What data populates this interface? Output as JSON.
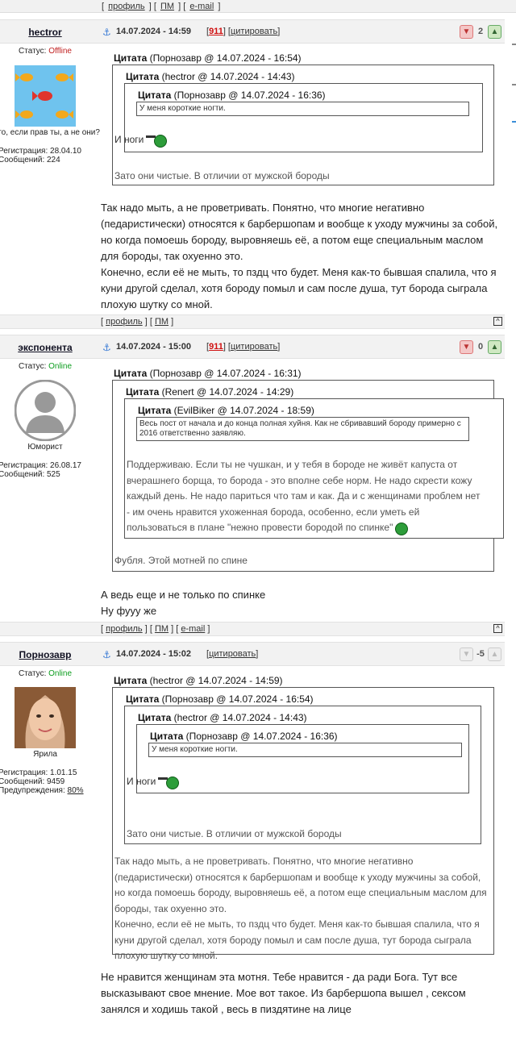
{
  "topbar": {
    "profile": "профиль",
    "pm": "ПМ",
    "email": "e-mail"
  },
  "common": {
    "quote_word": "Цитата",
    "cite_link": "цитировать",
    "profile_link": "профиль",
    "pm_link": "ПМ",
    "email_link": "e-mail",
    "to_top": "^",
    "status_label": "Статус:"
  },
  "posts": [
    {
      "author": "hectror",
      "status": "Offline",
      "tagline": "что, если прав ты, а не они?",
      "registration": "Регистрация: 28.04.10",
      "messages": "Сообщений: 224",
      "date": "14.07.2024 - 14:59",
      "badge": "911",
      "rating": "2",
      "quote1_head": "(Порнозавр @ 14.07.2024 - 16:54)",
      "quote2_head": "(hectror @ 14.07.2024 - 14:43)",
      "quote3_head": "(Порнозавр @ 14.07.2024 - 16:36)",
      "quote3_text": "У меня короткие ногти.",
      "quote2_text": "И ноги",
      "quote1_text": "Зато они чистые. В отличии от мужской бороды",
      "text1": "Так надо мыть, а не проветривать. Понятно, что многие негативно (педаристически) относятся к барбершопам и вообще к уходу мужчины за собой, но когда помоешь бороду, выровняешь её, а потом еще специальным маслом для бороды, так охуенно это.",
      "text2": "Конечно, если её не мыть, то пздц что будет. Меня как-то бывшая спалила, что я куни другой сделал, хотя бороду помыл и сам после душа, тут борода сыграла плохую шутку со мной."
    },
    {
      "author": "экспонента",
      "status": "Online",
      "tagline": "Юморист",
      "registration": "Регистрация: 26.08.17",
      "messages": "Сообщений: 525",
      "date": "14.07.2024 - 15:00",
      "badge": "911",
      "rating": "0",
      "quote1_head": "(Порнозавр @ 14.07.2024 - 16:31)",
      "quote2_head": "(Renert @ 14.07.2024 - 14:29)",
      "quote3_head": "(EvilBiker @ 14.07.2024 - 18:59)",
      "quote3_text": "Весь пост от начала и до конца полная хуйня. Как не сбривавший бороду примерно с 2016 ответственно заявляю.",
      "quote2_text": "Поддерживаю. Если ты не чушкан, и у тебя в бороде не живёт капуста от вчерашнего борща, то борода - это вполне себе норм. Не надо скрести кожу каждый день. Не надо париться что там и как. Да и с женщинами проблем нет - им очень нравится ухоженная борода, особенно, если уметь ей пользоваться в плане \"нежно провести бородой по спинке\"",
      "quote1_text": "Фубля. Этой мотней по спине",
      "text1": "А ведь еще и не только по спинке",
      "text2": "Ну фууу же"
    },
    {
      "author": "Порнозавр",
      "status": "Online",
      "tagline": "Ярила",
      "registration": "Регистрация: 1.01.15",
      "messages": "Сообщений: 9459",
      "warnings_label": "Предупреждения:",
      "warnings_value": "80%",
      "date": "14.07.2024 - 15:02",
      "rating": "-5",
      "quote1_head": "(hectror @ 14.07.2024 - 14:59)",
      "quote2_head": "(Порнозавр @ 14.07.2024 - 16:54)",
      "quote3_head": "(hectror @ 14.07.2024 - 14:43)",
      "quote4_head": "(Порнозавр @ 14.07.2024 - 16:36)",
      "quote4_text": "У меня короткие ногти.",
      "quote3_text": "И ноги",
      "quote2_text": "Зато они чистые. В отличии от мужской бороды",
      "quote1_text": "Так надо мыть, а не проветривать. Понятно, что многие негативно (педаристически) относятся к барбершопам и вообще к уходу мужчины за собой, но когда помоешь бороду, выровняешь её, а потом еще специальным маслом для бороды, так охуенно это.\nКонечно, если её не мыть, то пздц что будет. Меня как-то бывшая спалила, что я куни другой сделал, хотя бороду помыл и сам после душа, тут борода сыграла плохую шутку со мной.",
      "text1": "Не нравится женщинам эта мотня. Тебе нравится - да ради Бога. Тут все высказывают свое мнение. Мое вот такое. Из барбершопа вышел , сексом занялся и ходишь такой , весь в пиздятине на лице"
    }
  ]
}
